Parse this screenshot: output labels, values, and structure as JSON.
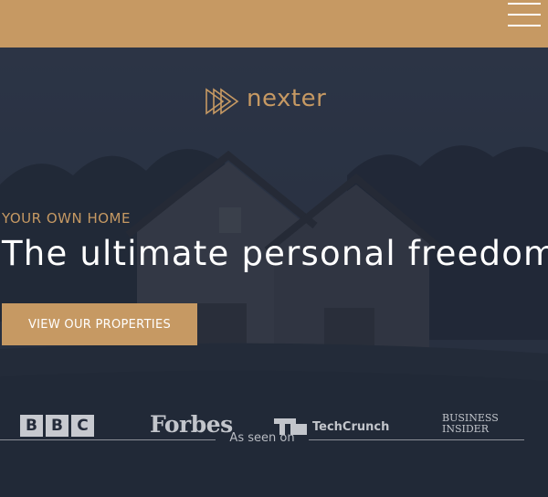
{
  "header": {
    "menu_icon": "hamburger-menu-icon",
    "background": "#c69963"
  },
  "hero": {
    "logo_text": "nexter",
    "logo_icon": "play-triangles-icon",
    "eyebrow": "YOUR OWN HOME",
    "headline": "The ultimate personal freedom",
    "cta_label": "VIEW OUR PROPERTIES"
  },
  "press": {
    "heading": "As seen on",
    "logos": {
      "bbc": [
        "B",
        "B",
        "C"
      ],
      "forbes": "Forbes",
      "techcrunch": "TechCrunch",
      "business_insider": [
        "BUSINESS",
        "INSIDER"
      ]
    }
  },
  "colors": {
    "accent": "#c69963",
    "hero_overlay": "#2a3142",
    "text_light": "#ffffff"
  }
}
